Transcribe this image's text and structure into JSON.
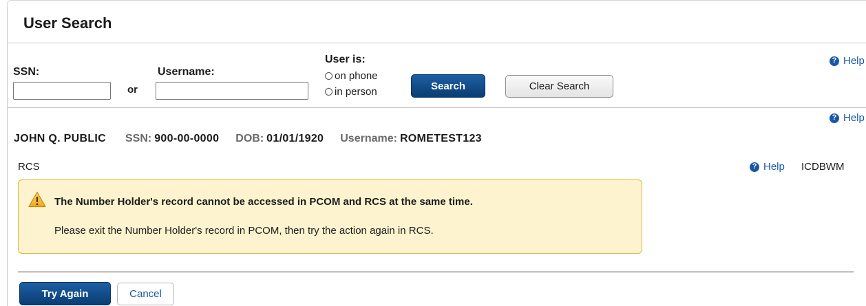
{
  "page": {
    "title": "User Search"
  },
  "search": {
    "ssn_label": "SSN:",
    "ssn_value": "",
    "or_label": "or",
    "username_label": "Username:",
    "username_value": "",
    "user_is_label": "User is:",
    "options": [
      "on phone",
      "in person"
    ],
    "search_button": "Search",
    "clear_button": "Clear Search",
    "help_label": "Help"
  },
  "record": {
    "help_label": "Help",
    "name": "JOHN Q. PUBLIC",
    "ssn_key": "SSN:",
    "ssn_value": "900-00-0000",
    "dob_key": "DOB:",
    "dob_value": "01/01/1920",
    "username_key": "Username:",
    "username_value": "ROMETEST123"
  },
  "section": {
    "label": "RCS",
    "help_label": "Help",
    "code": "ICDBWM"
  },
  "alert": {
    "icon": "warning-icon",
    "title": "The Number Holder's record cannot be accessed in PCOM and RCS at the same time.",
    "message": "Please exit the Number Holder's record in PCOM, then try the action again in RCS."
  },
  "actions": {
    "try_again": "Try Again",
    "cancel": "Cancel"
  },
  "colors": {
    "primary": "#0d4a88",
    "link": "#1a56a6",
    "alert_bg": "#fdf3cf",
    "alert_border": "#e0b73a"
  }
}
